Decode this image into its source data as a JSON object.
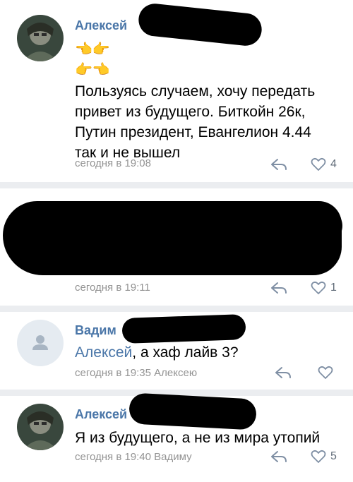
{
  "comments": [
    {
      "author": "Алексей",
      "emoji_line_1": "👈👉",
      "emoji_line_2": "👉👈",
      "text_lines": [
        "Пользуясь случаем, хочу передать",
        "привет из будущего. Биткойн 26к,",
        "Путин президент, Евангелион 4.44",
        "так и не вышел"
      ],
      "time": "сегодня в 19:08",
      "likes": "4"
    },
    {
      "time": "сегодня в 19:11",
      "likes": "1"
    },
    {
      "author": "Вадим",
      "mention": "Алексей",
      "text_rest": ", а хаф лайв 3?",
      "time": "сегодня в 19:35 Алексею",
      "likes": ""
    },
    {
      "author": "Алексей",
      "text": "Я из будущего, а не из мира утопий",
      "time": "сегодня в 19:40 Вадиму",
      "likes": "5"
    }
  ],
  "colors": {
    "link": "#4a76a8",
    "meta": "#939393",
    "separator": "#ebedf0",
    "icon": "#7f8fa4"
  }
}
